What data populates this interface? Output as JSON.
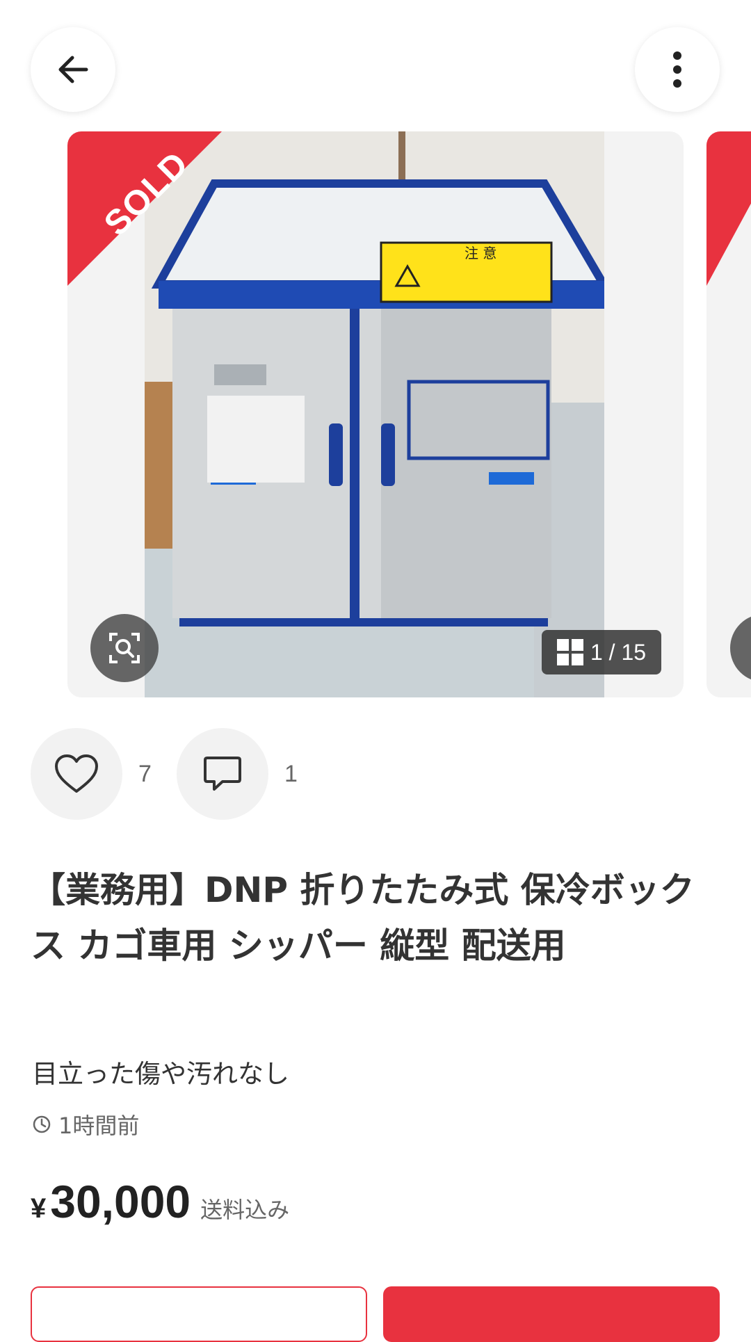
{
  "header": {
    "back_icon": "arrow-left-icon",
    "more_icon": "more-vertical-icon"
  },
  "gallery": {
    "sold_label": "SOLD",
    "current_index": 1,
    "total": 15,
    "counter_text": "1 / 15",
    "warning_label_text": "注 意"
  },
  "actions": {
    "like_count": "7",
    "comment_count": "1"
  },
  "item": {
    "title": "【業務用】DNP 折りたたみ式 保冷ボックス カゴ車用 シッパー 縦型 配送用",
    "condition": "目立った傷や汚れなし",
    "posted": "1時間前",
    "price_symbol": "¥",
    "price": "30,000",
    "shipping": "送料込み"
  },
  "colors": {
    "accent": "#e8323f",
    "text": "#333333",
    "muted": "#666666"
  }
}
